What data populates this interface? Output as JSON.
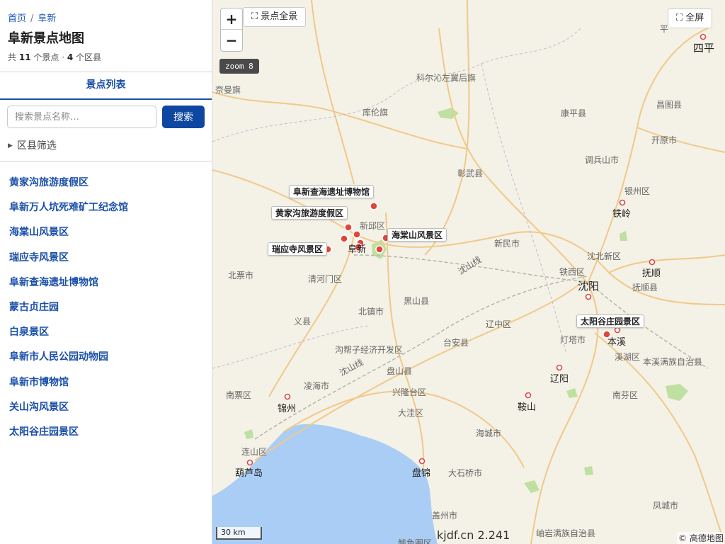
{
  "breadcrumb": {
    "home": "首页",
    "separator": "/",
    "current": "阜新"
  },
  "page_title": "阜新景点地图",
  "stats": {
    "prefix": "共",
    "spot_count": "11",
    "spot_unit": "个景点 ·",
    "county_count": "4",
    "county_unit": "个区县"
  },
  "tab": {
    "label": "景点列表"
  },
  "search": {
    "placeholder": "搜索景点名称…",
    "button": "搜索"
  },
  "filter": {
    "label": "区县筛选",
    "icon": "caret-right-icon"
  },
  "spots": [
    "黄家沟旅游度假区",
    "阜新万人坑死难矿工纪念馆",
    "海棠山风景区",
    "瑞应寺风景区",
    "阜新查海遗址博物馆",
    "蒙古贞庄园",
    "白泉景区",
    "阜新市人民公园动物园",
    "阜新市博物馆",
    "关山沟风景区",
    "太阳谷庄园景区"
  ],
  "map": {
    "zoom_in": "+",
    "zoom_out": "−",
    "overview_button": "⛶ 景点全景",
    "fullscreen_button": "⛶ 全屏",
    "zoom_badge": "zoom 8",
    "scale": "30 km",
    "version": "kjdf.cn 2.241",
    "attribution": "© 高德地图",
    "popups": [
      "阜新查海遗址博物馆",
      "黄家沟旅游度假区",
      "海棠山风景区",
      "瑞应寺风景区",
      "太阳谷庄园景区"
    ],
    "place_labels": {
      "keerqin": "科尔沁左翼后旗",
      "naiman": "奈曼旗",
      "kulun": "库伦旗",
      "kangping": "康平县",
      "changtu": "昌图县",
      "siping_qu": "平",
      "siping": "四平",
      "kaiyuan": "开原市",
      "diaobingshan": "调兵山市",
      "zhangwu": "彰武县",
      "yinzhou": "银州区",
      "tieling": "铁岭",
      "xinqiu": "新邱区",
      "fuxin": "阜新",
      "xinmin": "新民市",
      "shenbei": "沈北新区",
      "fushun": "抚顺",
      "fushunxian": "抚顺县",
      "tiexi": "铁西区",
      "shenyang": "沈阳",
      "beipiao": "北票市",
      "qinghemen": "清河门区",
      "heishan": "黑山县",
      "beizhen": "北镇市",
      "yixian": "义县",
      "liaozhong": "辽中区",
      "dengta": "灯塔市",
      "benxi": "本溪",
      "xihu": "溪湖区",
      "benximanzu": "本溪满族自治县",
      "goubangzi": "沟帮子经济开发区",
      "taian": "台安县",
      "liaoyang": "辽阳",
      "panshan": "盘山县",
      "linghai": "凌海市",
      "nanpiao": "南票区",
      "jinzhou": "锦州",
      "xinglongtai": "兴隆台区",
      "anshan": "鞍山",
      "nanfen": "南芬区",
      "dawa": "大洼区",
      "haicheng": "海城市",
      "lianshan": "连山区",
      "huludao": "葫芦岛",
      "panjin": "盘锦",
      "dashiqiao": "大石桥市",
      "gaizhou": "盖州市",
      "fengcheng": "凤城市",
      "xiuyan": "岫岩满族自治县",
      "bayuquan": "鲅鱼圈区",
      "shenshan_line1": "沈山线",
      "shenshan_line2": "沈山线"
    }
  }
}
